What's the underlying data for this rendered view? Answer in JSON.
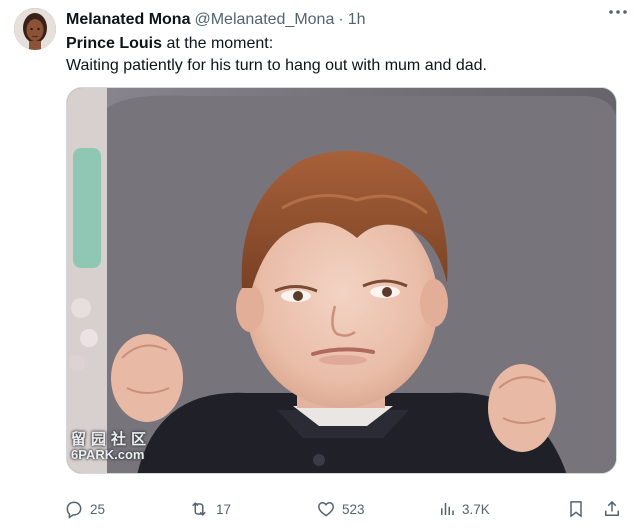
{
  "tweet": {
    "display_name": "Melanated Mona",
    "handle": "@Melanated_Mona",
    "separator": "·",
    "time": "1h",
    "text_bold": "Prince Louis",
    "text_line1_rest": " at the moment:",
    "text_line2": "Waiting patiently for his turn to hang out with mum and dad."
  },
  "media": {
    "watermark_cn": "留园社区",
    "watermark_en": "6PARK.com"
  },
  "actions": {
    "replies": "25",
    "reposts": "17",
    "likes": "523",
    "views": "3.7K"
  },
  "icons": {
    "more": "more-icon",
    "reply": "reply-icon",
    "repost": "repost-icon",
    "like": "heart-icon",
    "views": "views-icon",
    "bookmark": "bookmark-icon",
    "share": "share-icon"
  },
  "colors": {
    "text": "#0f1419",
    "secondary": "#536471",
    "border": "#cfd9de"
  }
}
